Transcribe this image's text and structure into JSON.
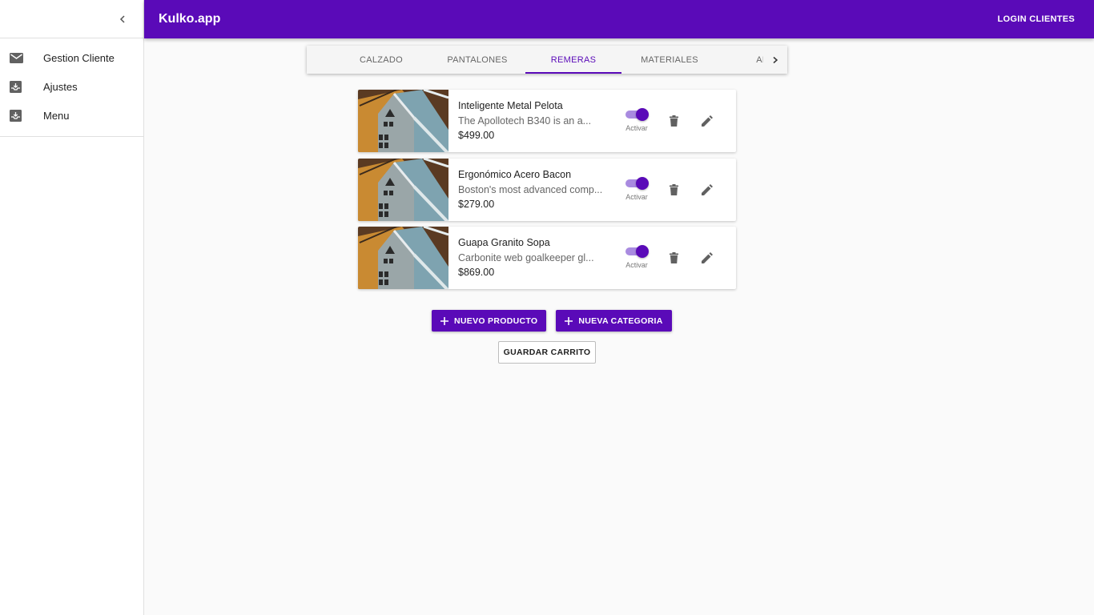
{
  "sidebar": {
    "items": [
      {
        "label": "Gestion Cliente",
        "icon": "mail-icon"
      },
      {
        "label": "Ajustes",
        "icon": "inbox-icon"
      },
      {
        "label": "Menu",
        "icon": "inbox-icon"
      }
    ]
  },
  "appbar": {
    "title": "Kulko.app",
    "login_label": "LOGIN CLIENTES"
  },
  "tabs": [
    {
      "label": "CALZADO",
      "active": false
    },
    {
      "label": "PANTALONES",
      "active": false
    },
    {
      "label": "REMERAS",
      "active": true
    },
    {
      "label": "MATERIALES",
      "active": false
    },
    {
      "label": "ABR",
      "active": false
    }
  ],
  "products": [
    {
      "name": "Inteligente Metal Pelota",
      "description": "The Apollotech B340 is an a...",
      "price": "$499.00",
      "toggle_label": "Activar",
      "active": true
    },
    {
      "name": "Ergonómico Acero Bacon",
      "description": "Boston's most advanced comp...",
      "price": "$279.00",
      "toggle_label": "Activar",
      "active": true
    },
    {
      "name": "Guapa Granito Sopa",
      "description": "Carbonite web goalkeeper gl...",
      "price": "$869.00",
      "toggle_label": "Activar",
      "active": true
    }
  ],
  "actions": {
    "new_product": "NUEVO PRODUCTO",
    "new_category": "NUEVA CATEGORIA",
    "save_cart": "GUARDAR CARRITO"
  },
  "colors": {
    "primary": "#5a0ab8",
    "toggle_track": "#a98be0",
    "background": "#fafafa"
  }
}
